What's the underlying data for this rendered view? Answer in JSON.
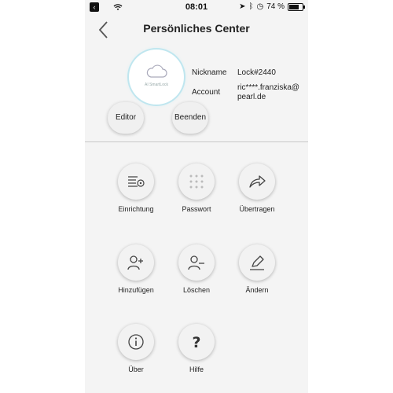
{
  "status_bar": {
    "time": "08:01",
    "battery_text": "74 %"
  },
  "header": {
    "title": "Persönliches Center"
  },
  "profile": {
    "avatar_text": "AI SmartLock",
    "nickname_label": "Nickname",
    "nickname_value": "Lock#2440",
    "account_label": "Account",
    "account_value": "ric****.franziska@pearl.de",
    "editor_label": "Editor",
    "beenden_label": "Beenden"
  },
  "menu": [
    {
      "label": "Einrichtung",
      "icon": "settings-list-icon"
    },
    {
      "label": "Passwort",
      "icon": "keypad-icon"
    },
    {
      "label": "Übertragen",
      "icon": "share-arrow-icon"
    },
    {
      "label": "Hinzufügen",
      "icon": "add-user-icon"
    },
    {
      "label": "Löschen",
      "icon": "remove-user-icon"
    },
    {
      "label": "Ändern",
      "icon": "edit-pencil-icon"
    },
    {
      "label": "Über",
      "icon": "info-icon"
    },
    {
      "label": "Hilfe",
      "icon": "help-icon"
    }
  ]
}
